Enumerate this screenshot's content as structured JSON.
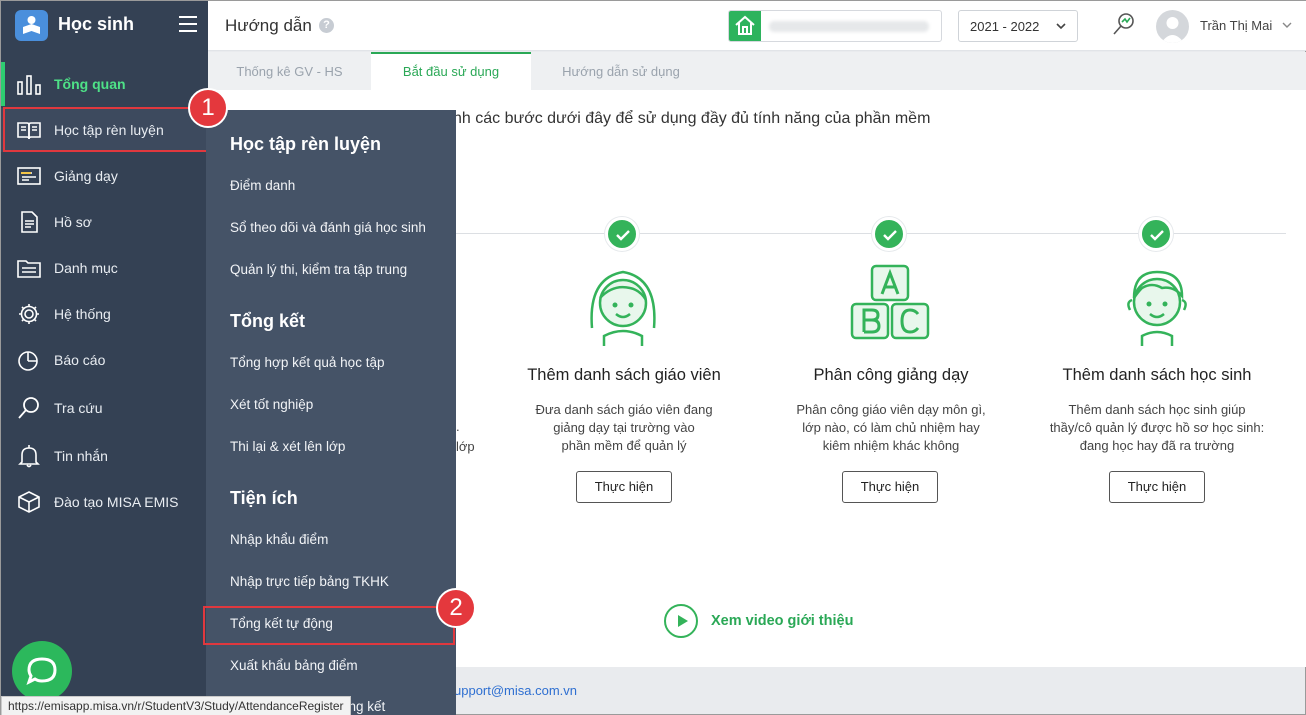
{
  "app": {
    "name": "Học sinh"
  },
  "sidebar": {
    "items": [
      {
        "label": "Tổng quan",
        "icon": "chart-bars-icon"
      },
      {
        "label": "Học tập rèn luyện",
        "icon": "book-icon"
      },
      {
        "label": "Giảng dạy",
        "icon": "board-icon"
      },
      {
        "label": "Hồ sơ",
        "icon": "file-icon"
      },
      {
        "label": "Danh mục",
        "icon": "folder-icon"
      },
      {
        "label": "Hệ thống",
        "icon": "gear-icon"
      },
      {
        "label": "Báo cáo",
        "icon": "pie-chart-icon"
      },
      {
        "label": "Tra cứu",
        "icon": "search-icon"
      },
      {
        "label": "Tin nhắn",
        "icon": "bell-icon"
      },
      {
        "label": "Đào tạo MISA EMIS",
        "icon": "cube-icon"
      }
    ]
  },
  "flyout": {
    "sections": [
      {
        "heading": "Học tập rèn luyện",
        "items": [
          "Điểm danh",
          "Sổ theo dõi và đánh giá học sinh",
          "Quản lý thi, kiểm tra tập trung"
        ]
      },
      {
        "heading": "Tổng kết",
        "items": [
          "Tổng hợp kết quả học tập",
          "Xét tốt nghiệp",
          "Thi lại & xét lên lớp"
        ]
      },
      {
        "heading": "Tiện ích",
        "items": [
          "Nhập khẩu điểm",
          "Nhập trực tiếp bảng TKHK",
          "Tổng kết tự động",
          "Xuất khẩu bảng điểm"
        ]
      }
    ],
    "tail_fragment": "ổng kết"
  },
  "callouts": {
    "one": "1",
    "two": "2"
  },
  "header": {
    "title": "Hướng dẫn",
    "help": "?",
    "year": "2021 - 2022",
    "user": "Trần Thị Mai"
  },
  "tabs": [
    {
      "label": "Thống kê GV - HS"
    },
    {
      "label": "Bắt đầu sử dụng"
    },
    {
      "label": "Hướng dẫn sử dụng"
    }
  ],
  "main": {
    "intro": "nh các bước dưới đây để sử dụng đầy đủ tính năng của phần mềm",
    "partial_1": ".",
    "partial_2": "lớp",
    "steps": [
      {
        "title": "Thêm danh sách giáo viên",
        "desc": [
          "Đưa danh sách giáo viên đang",
          "giảng dạy tại trường vào",
          "phần mềm để quản lý"
        ],
        "button": "Thực hiện"
      },
      {
        "title": "Phân công giảng dạy",
        "desc": [
          "Phân công giáo viên dạy môn gì,",
          "lớp nào, có làm chủ nhiệm hay",
          "kiêm nhiệm khác không"
        ],
        "button": "Thực hiện"
      },
      {
        "title": "Thêm danh sách học sinh",
        "desc": [
          "Thêm danh sách học sinh giúp",
          "thầy/cô quản lý được hồ sơ học sinh:",
          "đang học hay đã ra trường"
        ],
        "button": "Thực hiện"
      }
    ],
    "video_link": "Xem video giới thiệu"
  },
  "footer": {
    "email": "upport@misa.com.vn"
  },
  "statusbar": {
    "url": "https://emisapp.misa.vn/r/StudentV3/Study/AttendanceRegister"
  },
  "colors": {
    "accent": "#2aa856",
    "sidebar": "#344154",
    "flyout": "#455367",
    "highlight": "#e0383e"
  }
}
